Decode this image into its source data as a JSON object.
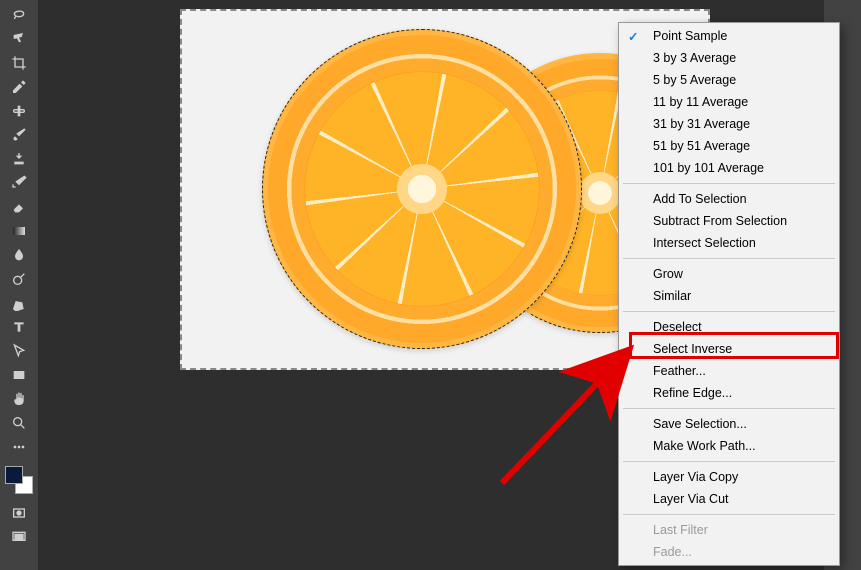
{
  "tools": [
    {
      "name": "lasso-tool-icon"
    },
    {
      "name": "quick-selection-tool-icon"
    },
    {
      "name": "crop-tool-icon"
    },
    {
      "name": "eyedropper-tool-icon"
    },
    {
      "name": "spot-healing-tool-icon"
    },
    {
      "name": "brush-tool-icon"
    },
    {
      "name": "clone-stamp-tool-icon"
    },
    {
      "name": "history-brush-tool-icon"
    },
    {
      "name": "eraser-tool-icon"
    },
    {
      "name": "gradient-tool-icon"
    },
    {
      "name": "blur-tool-icon"
    },
    {
      "name": "dodge-tool-icon"
    },
    {
      "name": "pen-tool-icon"
    },
    {
      "name": "type-tool-icon"
    },
    {
      "name": "path-selection-tool-icon"
    },
    {
      "name": "rectangle-tool-icon"
    },
    {
      "name": "hand-tool-icon"
    },
    {
      "name": "zoom-tool-icon"
    },
    {
      "name": "edit-toolbar-icon"
    }
  ],
  "swatches": {
    "fg": "#0a1a3a",
    "bg": "#ffffff"
  },
  "extra_tools": [
    {
      "name": "quick-mask-icon"
    },
    {
      "name": "screen-mode-icon"
    }
  ],
  "context_menu": {
    "groups": [
      {
        "items": [
          {
            "label": "Point Sample",
            "checked": true
          },
          {
            "label": "3 by 3 Average"
          },
          {
            "label": "5 by 5 Average"
          },
          {
            "label": "11 by 11 Average"
          },
          {
            "label": "31 by 31 Average"
          },
          {
            "label": "51 by 51 Average"
          },
          {
            "label": "101 by 101 Average"
          }
        ]
      },
      {
        "items": [
          {
            "label": "Add To Selection"
          },
          {
            "label": "Subtract From Selection"
          },
          {
            "label": "Intersect Selection"
          }
        ]
      },
      {
        "items": [
          {
            "label": "Grow"
          },
          {
            "label": "Similar"
          }
        ]
      },
      {
        "items": [
          {
            "label": "Deselect"
          },
          {
            "label": "Select Inverse",
            "highlighted": true
          },
          {
            "label": "Feather..."
          },
          {
            "label": "Refine Edge..."
          }
        ]
      },
      {
        "items": [
          {
            "label": "Save Selection..."
          },
          {
            "label": "Make Work Path..."
          }
        ]
      },
      {
        "items": [
          {
            "label": "Layer Via Copy"
          },
          {
            "label": "Layer Via Cut"
          }
        ]
      },
      {
        "items": [
          {
            "label": "Last Filter",
            "disabled": true
          },
          {
            "label": "Fade...",
            "disabled": true
          }
        ]
      }
    ]
  },
  "annotation": {
    "highlighted_item": "Select Inverse"
  }
}
